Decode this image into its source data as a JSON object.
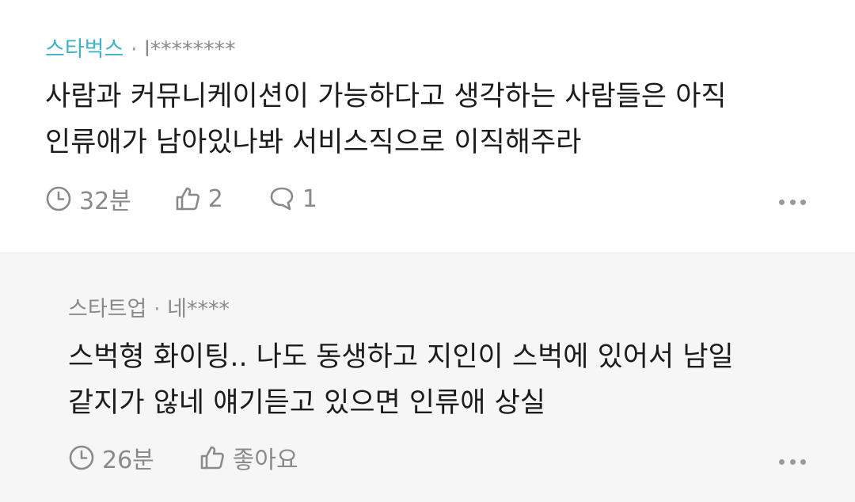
{
  "post": {
    "company": "스타벅스",
    "separator": "·",
    "author": "l********",
    "lines": [
      "사람과 커뮤니케이션이 가능하다고 생각하는 사람들은 아직",
      "인류애가 남아있나봐 서비스직으로 이직해주라"
    ],
    "time": "32분",
    "likes": "2",
    "comments": "1",
    "icons": [
      "clock-icon",
      "thumbs-up-icon",
      "comment-icon",
      "more-icon"
    ]
  },
  "reply": {
    "company": "스타트업",
    "separator": "·",
    "author": "네****",
    "lines": [
      "스벅형 화이팅.. 나도 동생하고 지인이 스벅에 있어서 남일",
      "같지가 않네 얘기듣고 있으면 인류애 상실"
    ],
    "time": "26분",
    "like_label": "좋아요",
    "icons": [
      "clock-icon",
      "thumbs-up-icon",
      "more-icon"
    ]
  },
  "colors": {
    "company_link": "#44b2c5",
    "meta_gray": "#8a8a8a",
    "body_text": "#1c1c1c",
    "reply_background": "#f6f6f6"
  }
}
